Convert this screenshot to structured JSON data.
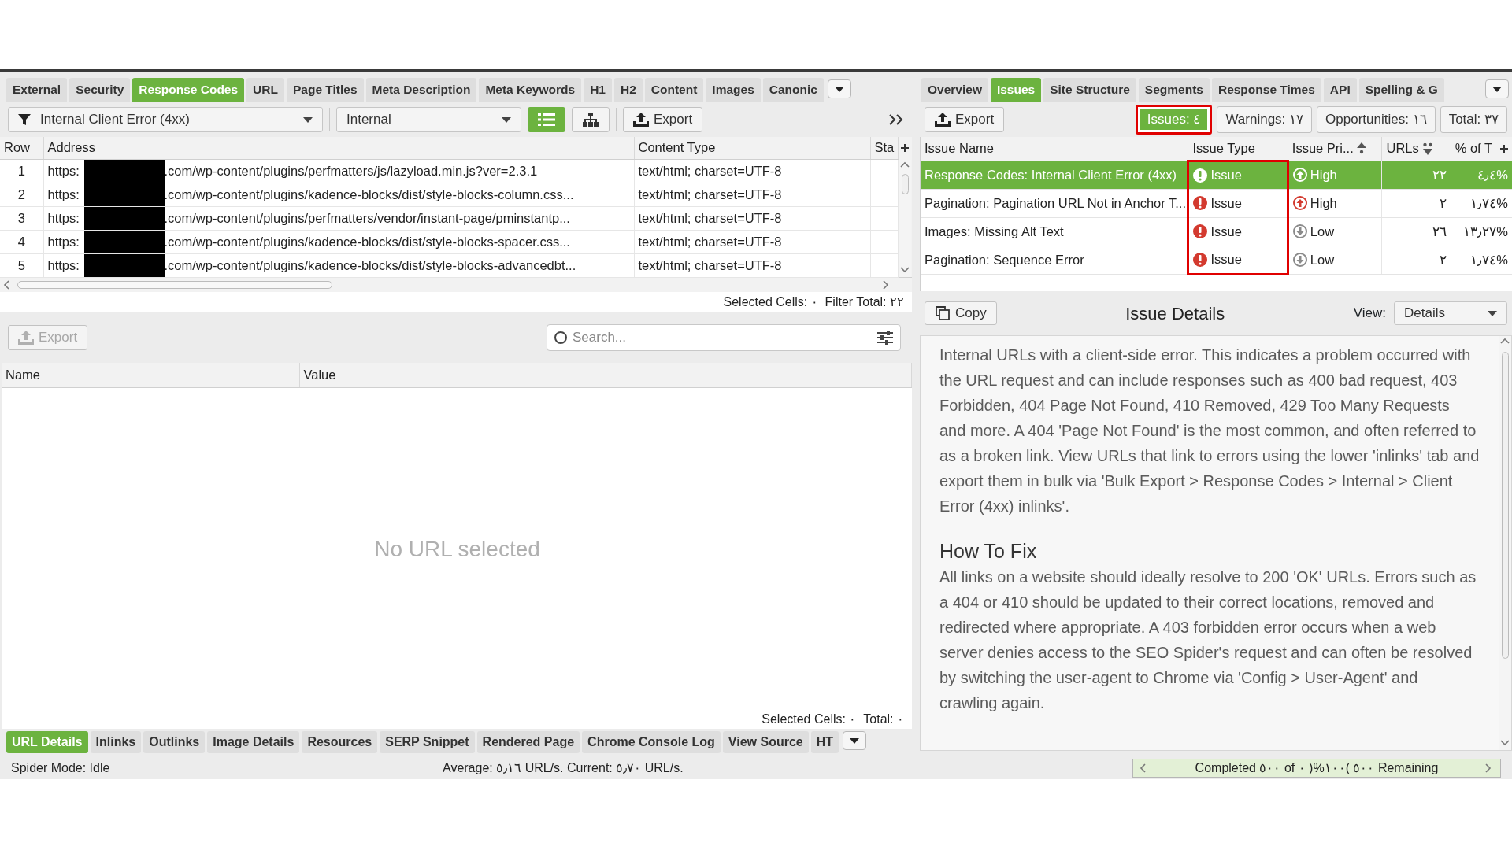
{
  "left_tabs": [
    {
      "label": "External",
      "selected": false
    },
    {
      "label": "Security",
      "selected": false
    },
    {
      "label": "Response Codes",
      "selected": true
    },
    {
      "label": "URL",
      "selected": false
    },
    {
      "label": "Page Titles",
      "selected": false
    },
    {
      "label": "Meta Description",
      "selected": false
    },
    {
      "label": "Meta Keywords",
      "selected": false
    },
    {
      "label": "H1",
      "selected": false
    },
    {
      "label": "H2",
      "selected": false
    },
    {
      "label": "Content",
      "selected": false
    },
    {
      "label": "Images",
      "selected": false
    },
    {
      "label": "Canonic",
      "selected": false
    }
  ],
  "filter": {
    "value": "Internal Client Error (4xx)"
  },
  "scope": {
    "value": "Internal"
  },
  "view_modes": [
    {
      "kind": "list",
      "selected": true
    },
    {
      "kind": "tree",
      "selected": false
    }
  ],
  "export": {
    "label": "Export"
  },
  "url_table": {
    "columns": [
      "Row",
      "Address",
      "Content Type",
      "Sta"
    ],
    "rows": [
      {
        "row": "1",
        "address_start": "https:",
        "address_end": ".com/wp-content/plugins/perfmatters/js/lazyload.min.js?ver=2.3.1",
        "content_type": "text/html; charset=UTF-8"
      },
      {
        "row": "2",
        "address_start": "https:",
        "address_end": ".com/wp-content/plugins/kadence-blocks/dist/style-blocks-column.css...",
        "content_type": "text/html; charset=UTF-8"
      },
      {
        "row": "3",
        "address_start": "https:",
        "address_end": ".com/wp-content/plugins/perfmatters/vendor/instant-page/pminstantp...",
        "content_type": "text/html; charset=UTF-8"
      },
      {
        "row": "4",
        "address_start": "https:",
        "address_end": ".com/wp-content/plugins/kadence-blocks/dist/style-blocks-spacer.css...",
        "content_type": "text/html; charset=UTF-8"
      },
      {
        "row": "5",
        "address_start": "https:",
        "address_end": ".com/wp-content/plugins/kadence-blocks/dist/style-blocks-advancedbt...",
        "content_type": "text/html; charset=UTF-8"
      }
    ],
    "footer": "Selected Cells: ٠  Filter Total: ٢٢"
  },
  "lower": {
    "export": {
      "label": "Export",
      "disabled": true
    },
    "search": {
      "placeholder": "Search..."
    },
    "columns": [
      "Name",
      "Value"
    ],
    "empty_message": "No URL selected",
    "footer": "Selected Cells: ٠  Total: ٠"
  },
  "bottom_tabs": [
    {
      "label": "URL Details",
      "selected": true
    },
    {
      "label": "Inlinks",
      "selected": false
    },
    {
      "label": "Outlinks",
      "selected": false
    },
    {
      "label": "Image Details",
      "selected": false
    },
    {
      "label": "Resources",
      "selected": false
    },
    {
      "label": "SERP Snippet",
      "selected": false
    },
    {
      "label": "Rendered Page",
      "selected": false
    },
    {
      "label": "Chrome Console Log",
      "selected": false
    },
    {
      "label": "View Source",
      "selected": false
    },
    {
      "label": "HT",
      "selected": false
    }
  ],
  "right_tabs": [
    {
      "label": "Overview",
      "selected": false
    },
    {
      "label": "Issues",
      "selected": true
    },
    {
      "label": "Site Structure",
      "selected": false
    },
    {
      "label": "Segments",
      "selected": false
    },
    {
      "label": "Response Times",
      "selected": false
    },
    {
      "label": "API",
      "selected": false
    },
    {
      "label": "Spelling & G",
      "selected": false
    }
  ],
  "right_export": {
    "label": "Export"
  },
  "summary": [
    {
      "label": "Issues: ٤",
      "selected": true,
      "highlighted": true
    },
    {
      "label": "Warnings: ١٧",
      "selected": false,
      "highlighted": false
    },
    {
      "label": "Opportunities: ١٦",
      "selected": false,
      "highlighted": false
    },
    {
      "label": "Total: ٣٧",
      "selected": false,
      "highlighted": false
    }
  ],
  "issues_table": {
    "columns": [
      {
        "label": "Issue Name",
        "kind": "plain"
      },
      {
        "label": "Issue Type",
        "kind": "plain",
        "highlighted": true
      },
      {
        "label": "Issue Pri...",
        "kind": "ascending"
      },
      {
        "label": "URLs",
        "kind": "descending"
      },
      {
        "label": "% of T",
        "kind": "plain"
      }
    ],
    "rows": [
      {
        "name": "Response Codes: Internal Client Error (4xx)",
        "type": "Issue",
        "priority": {
          "label": "High",
          "kind": "high"
        },
        "urls": "٢٢",
        "percent": "٤٫٤%",
        "selected": true
      },
      {
        "name": "Pagination: Pagination URL Not in Anchor T...",
        "type": "Issue",
        "priority": {
          "label": "High",
          "kind": "high"
        },
        "urls": "٢",
        "percent": "١٫٧٤%",
        "selected": false
      },
      {
        "name": "Images: Missing Alt Text",
        "type": "Issue",
        "priority": {
          "label": "Low",
          "kind": "low"
        },
        "urls": "٢٦",
        "percent": "١٣٫٢٧%",
        "selected": false
      },
      {
        "name": "Pagination: Sequence Error",
        "type": "Issue",
        "priority": {
          "label": "Low",
          "kind": "low"
        },
        "urls": "٢",
        "percent": "١٫٧٤%",
        "selected": false
      }
    ]
  },
  "details": {
    "copy": "Copy",
    "title": "Issue Details",
    "view_label": "View:",
    "view_value": "Details",
    "description": "Internal URLs with a client-side error. This indicates a problem occurred with the URL request and can include responses such as 400 bad request, 403 Forbidden, 404 Page Not Found, 410 Removed, 429 Too Many Requests and more. A 404 'Page Not Found' is the most common, and often referred to as a broken link. View URLs that link to errors using the lower 'inlinks' tab and export them in bulk via 'Bulk Export > Response Codes > Internal > Client Error (4xx) inlinks'.",
    "fix_title": "How To Fix",
    "fix_text": "All links on a website should ideally resolve to 200 'OK' URLs. Errors such as a 404 or 410 should be updated to their correct locations, removed and redirected where appropriate. A 403 forbidden error occurs when a web server denies access to the SEO Spider's request and can often be resolved by switching the user-agent to Chrome via 'Config > User-Agent' and crawling again."
  },
  "status": {
    "mode": "Spider Mode: Idle",
    "speed": "Average: ٥٫١٦ URL/s. Current: ٥٫٧٠ URL/s.",
    "progress": "Completed ٥٠٠ of ٠ )%١٠٠( ٥٠٠ Remaining",
    "level": 1
  }
}
